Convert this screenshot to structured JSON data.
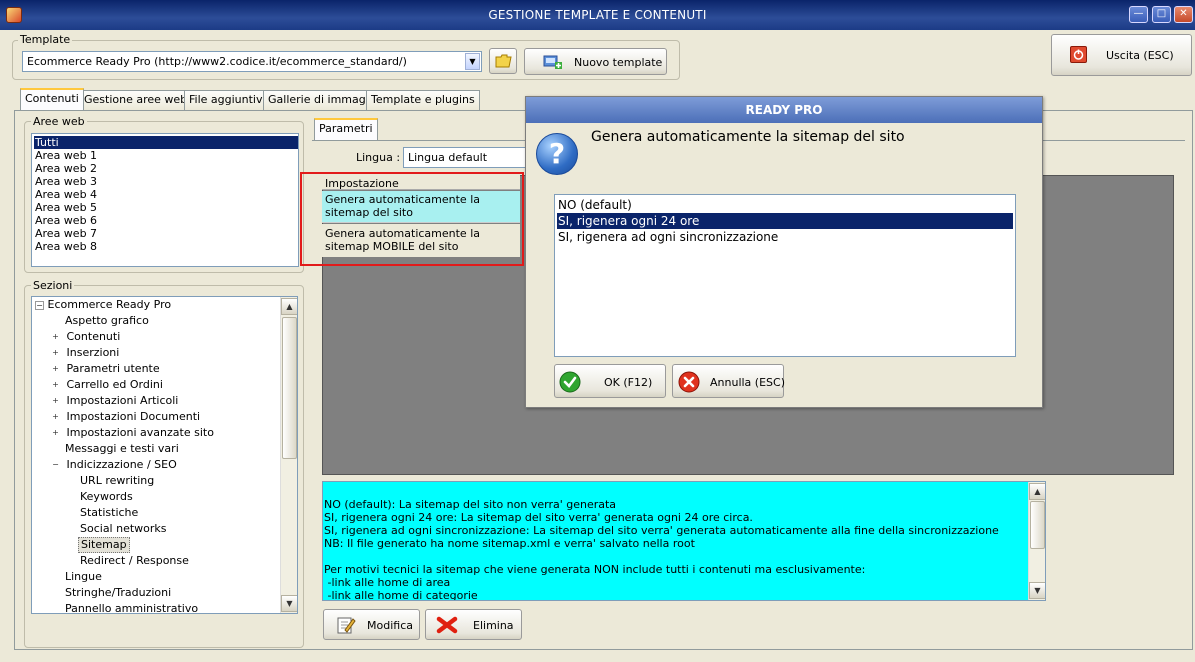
{
  "window": {
    "title": "GESTIONE TEMPLATE E CONTENUTI",
    "minimize_glyph": "—",
    "maximize_glyph": "□",
    "close_glyph": "✕"
  },
  "template_group": {
    "label": "Template",
    "selected": "Ecommerce Ready Pro (http://www2.codice.it/ecommerce_standard/)",
    "dropdown_glyph": "▼",
    "new_template_label": "Nuovo template"
  },
  "exit_button": {
    "label": "Uscita (ESC)"
  },
  "tabs": [
    {
      "label": "Contenuti"
    },
    {
      "label": "Gestione aree web"
    },
    {
      "label": "File aggiuntivi"
    },
    {
      "label": "Gallerie di immagini"
    },
    {
      "label": "Template e plugins"
    }
  ],
  "aree_web": {
    "label": "Aree web",
    "items": [
      "Tutti",
      "Area web 1",
      "Area web 2",
      "Area web 3",
      "Area web 4",
      "Area web 5",
      "Area web 6",
      "Area web 7",
      "Area web 8"
    ],
    "selected_index": 0
  },
  "sezioni": {
    "label": "Sezioni",
    "items": [
      {
        "label": "Ecommerce Ready Pro",
        "expander": "−"
      },
      {
        "label": "Aspetto grafico",
        "expander": ""
      },
      {
        "label": "Contenuti",
        "expander": "+"
      },
      {
        "label": "Inserzioni",
        "expander": "+"
      },
      {
        "label": "Parametri utente",
        "expander": "+"
      },
      {
        "label": "Carrello ed Ordini",
        "expander": "+"
      },
      {
        "label": "Impostazioni Articoli",
        "expander": "+"
      },
      {
        "label": "Impostazioni Documenti",
        "expander": "+"
      },
      {
        "label": "Impostazioni avanzate sito",
        "expander": "+"
      },
      {
        "label": "Messaggi e testi vari",
        "expander": ""
      },
      {
        "label": "Indicizzazione / SEO",
        "expander": "−"
      },
      {
        "label": "URL rewriting",
        "expander": ""
      },
      {
        "label": "Keywords",
        "expander": ""
      },
      {
        "label": "Statistiche",
        "expander": ""
      },
      {
        "label": "Social networks",
        "expander": ""
      },
      {
        "label": "Sitemap",
        "expander": ""
      },
      {
        "label": "Redirect / Response",
        "expander": ""
      },
      {
        "label": "Lingue",
        "expander": ""
      },
      {
        "label": "Stringhe/Traduzioni",
        "expander": ""
      },
      {
        "label": "Pannello amministrativo",
        "expander": ""
      }
    ],
    "scroll_up": "▲",
    "scroll_down": "▼"
  },
  "parametri": {
    "tab_label": "Parametri",
    "lingua_label": "Lingua :",
    "lingua_value": "Lingua default",
    "grid_header": "Impostazione",
    "rows": [
      "Genera automaticamente la sitemap del sito",
      "Genera automaticamente la sitemap MOBILE del sito"
    ]
  },
  "description": {
    "lines": [
      "NO (default): La sitemap del sito non verra' generata",
      "SI, rigenera ogni 24 ore: La sitemap del sito verra' generata ogni 24 ore circa.",
      "SI, rigenera ad ogni sincronizzazione: La sitemap del sito verra' generata automaticamente alla fine della sincronizzazione",
      "NB: Il file generato ha nome sitemap.xml e verra' salvato nella root",
      "",
      "Per motivi tecnici la sitemap che viene generata NON include tutti i contenuti ma esclusivamente:",
      " -link alle home di area",
      " -link alle home di categorie"
    ],
    "scroll_up": "▲",
    "scroll_down": "▼"
  },
  "bottom_buttons": {
    "modifica": "Modifica",
    "elimina": "Elimina"
  },
  "dialog": {
    "title": "READY PRO",
    "question": "Genera automaticamente la sitemap del sito",
    "icon_glyph": "?",
    "options": [
      "NO (default)",
      "SI, rigenera ogni 24 ore",
      "SI, rigenera ad ogni sincronizzazione"
    ],
    "selected_index": 1,
    "ok_label": "OK (F12)",
    "cancel_label": "Annulla (ESC)"
  },
  "colors": {
    "highlight_row": "#a8f0f0",
    "description_bg": "#00ffff",
    "selection": "#0a246a",
    "red_frame": "#e21b1b"
  }
}
